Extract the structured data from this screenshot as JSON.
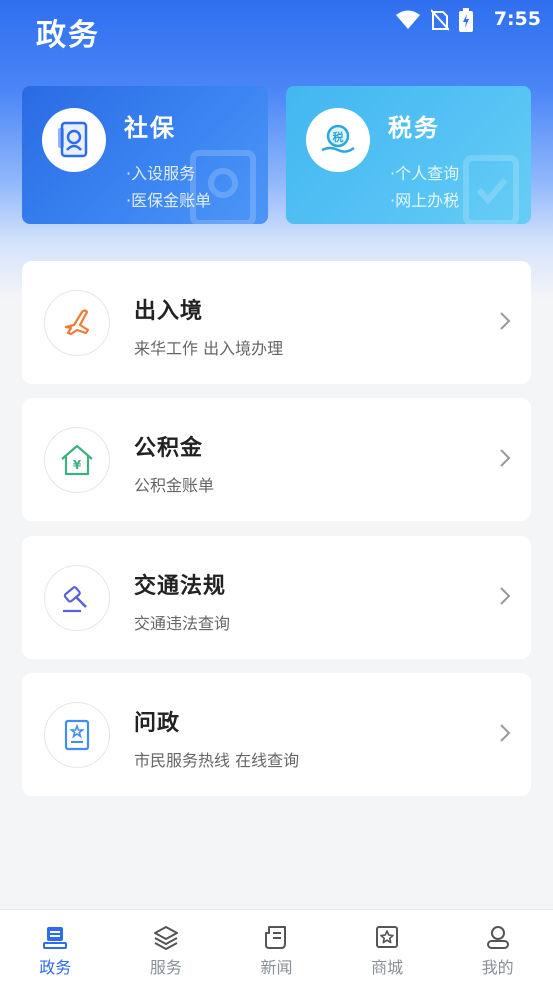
{
  "status_bar": {
    "time": "7:55",
    "icons": [
      "wifi-icon",
      "no-sim-icon",
      "battery-charging-icon"
    ]
  },
  "header": {
    "title": "政务"
  },
  "top_cards": [
    {
      "title": "社保",
      "items": [
        "·入设服务",
        "·医保金账单"
      ],
      "icon": "social-security-icon"
    },
    {
      "title": "税务",
      "items": [
        "·个人查询",
        "·网上办税"
      ],
      "icon": "tax-icon"
    }
  ],
  "services": [
    {
      "title": "出入境",
      "subtitle": "来华工作 出入境办理",
      "icon": "airplane-icon",
      "color": "#f07a3a"
    },
    {
      "title": "公积金",
      "subtitle": "公积金账单",
      "icon": "house-yuan-icon",
      "color": "#3fb07c"
    },
    {
      "title": "交通法规",
      "subtitle": "交通违法查询",
      "icon": "gavel-icon",
      "color": "#5b62d6"
    },
    {
      "title": "问政",
      "subtitle": "市民服务热线 在线查询",
      "icon": "certificate-icon",
      "color": "#3f8ef0"
    }
  ],
  "tabbar": {
    "tabs": [
      {
        "label": "政务",
        "icon": "government-icon",
        "active": true
      },
      {
        "label": "服务",
        "icon": "layers-icon",
        "active": false
      },
      {
        "label": "新闻",
        "icon": "news-icon",
        "active": false
      },
      {
        "label": "商城",
        "icon": "shop-icon",
        "active": false
      },
      {
        "label": "我的",
        "icon": "user-icon",
        "active": false
      }
    ]
  },
  "colors": {
    "accent": "#2d6cf0",
    "inactive": "#8a8f99"
  }
}
